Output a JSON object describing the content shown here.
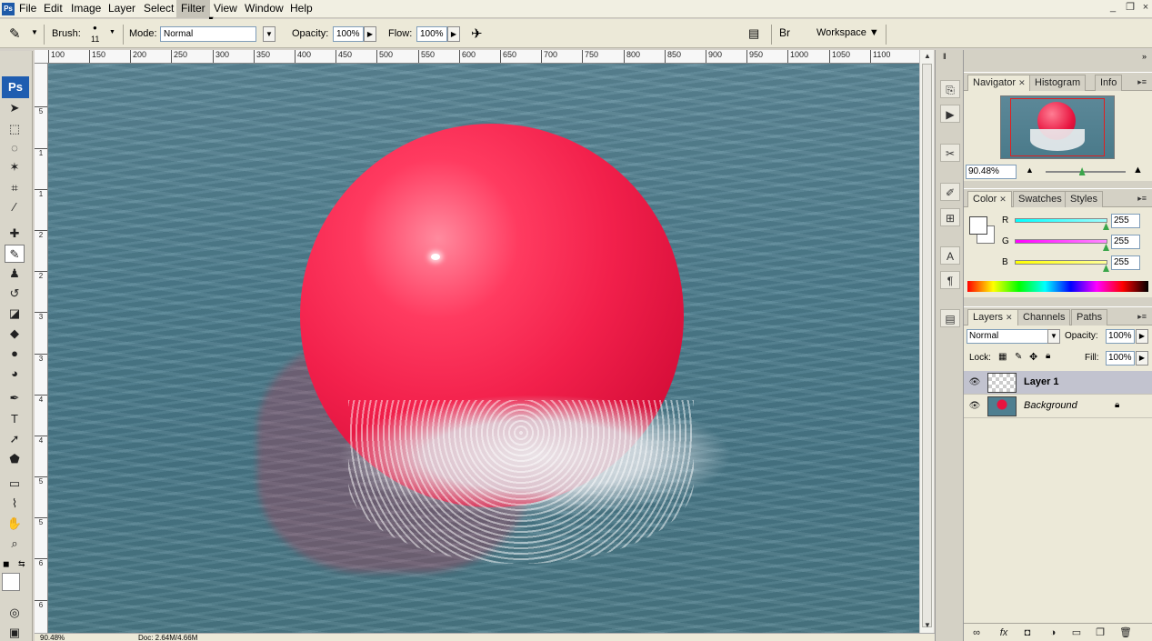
{
  "menubar": {
    "logo": "Ps",
    "items": [
      "File",
      "Edit",
      "Image",
      "Layer",
      "Select",
      "Filter",
      "View",
      "Window",
      "Help"
    ],
    "active_item": "Filter",
    "window_controls": [
      "_",
      "❐",
      "×"
    ]
  },
  "options": {
    "brush_label": "Brush:",
    "brush_size": "11",
    "mode_label": "Mode:",
    "mode_value": "Normal",
    "opacity_label": "Opacity:",
    "opacity_value": "100%",
    "flow_label": "Flow:",
    "flow_value": "100%",
    "workspace_label": "Workspace ▼"
  },
  "toolbox": {
    "badge": "Ps",
    "tools": [
      "move-tool",
      "marquee-tool",
      "lasso-tool",
      "magic-wand-tool",
      "crop-tool",
      "slice-tool",
      "healing-brush-tool",
      "brush-tool",
      "clone-stamp-tool",
      "history-brush-tool",
      "eraser-tool",
      "paint-bucket-tool",
      "blur-tool",
      "dodge-tool",
      "pen-tool",
      "type-tool",
      "path-selection-tool",
      "shape-tool",
      "notes-tool",
      "eyedropper-tool",
      "hand-tool",
      "zoom-tool"
    ],
    "active_tool": "brush-tool"
  },
  "rulers": {
    "top": [
      "100",
      "150",
      "200",
      "250",
      "300",
      "350",
      "400",
      "450",
      "500",
      "550",
      "600",
      "650",
      "700",
      "750",
      "800",
      "850",
      "900",
      "950",
      "1000",
      "1050",
      "1100"
    ],
    "left": [
      "5",
      "1",
      "1",
      "2",
      "2",
      "3",
      "3",
      "4",
      "4",
      "5",
      "5",
      "6",
      "6"
    ]
  },
  "status": {
    "zoom": "90.48%",
    "doc": "Doc: 2.64M/4.66M"
  },
  "navigator": {
    "tabs": [
      "Navigator",
      "Histogram",
      "Info"
    ],
    "active_tab": "Navigator",
    "zoom": "90.48%",
    "zoom_level": 0.45
  },
  "color": {
    "tabs": [
      "Color",
      "Swatches",
      "Styles"
    ],
    "active_tab": "Color",
    "channels": [
      {
        "label": "R",
        "value": "255",
        "color": "#00e5e5"
      },
      {
        "label": "G",
        "value": "255",
        "color": "#e500e5"
      },
      {
        "label": "B",
        "value": "255",
        "color": "#e5e500"
      }
    ],
    "foreground": "#ffffff"
  },
  "layers": {
    "tabs": [
      "Layers",
      "Channels",
      "Paths"
    ],
    "active_tab": "Layers",
    "blend_mode": "Normal",
    "opacity_label": "Opacity:",
    "opacity_value": "100%",
    "lock_label": "Lock:",
    "fill_label": "Fill:",
    "fill_value": "100%",
    "rows": [
      {
        "name": "Layer 1",
        "selected": true
      },
      {
        "name": "Background",
        "selected": false,
        "locked": true
      }
    ]
  },
  "colors": {
    "accent": "#1f5db0",
    "sphere": "#f2204b",
    "water": "#4f7f90"
  }
}
